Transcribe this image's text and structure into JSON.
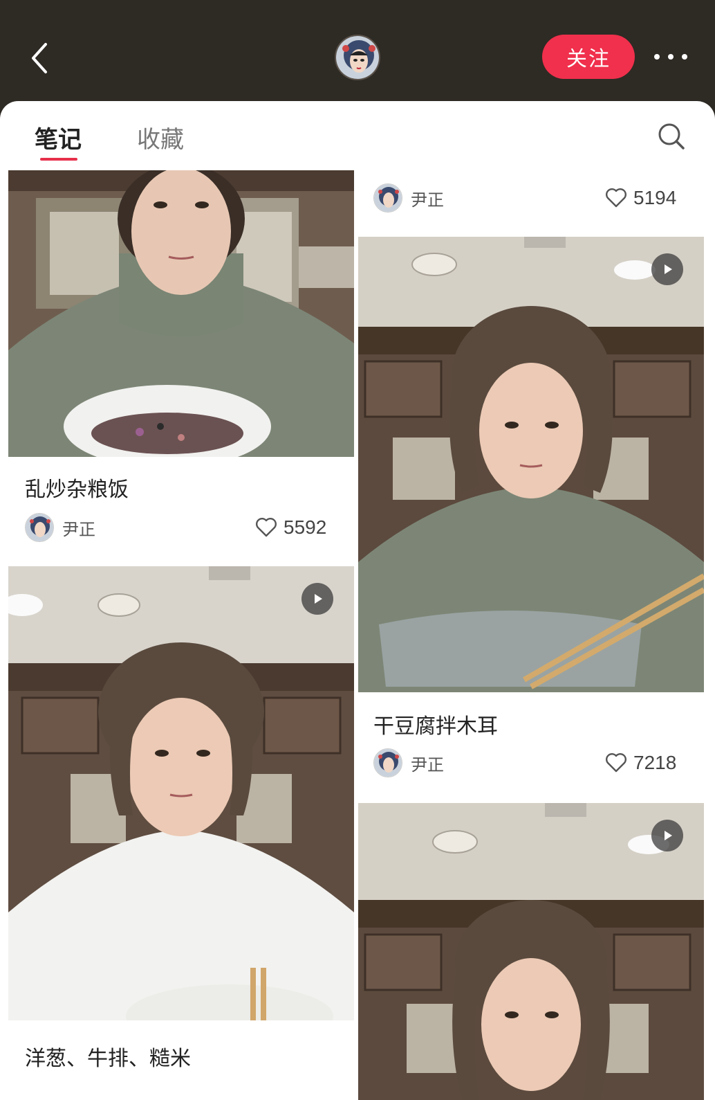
{
  "header": {
    "follow_label": "关注"
  },
  "tabs": [
    {
      "label": "笔记",
      "active": true
    },
    {
      "label": "收藏",
      "active": false
    }
  ],
  "author": "尹正",
  "notes": [
    {
      "title": "乱炒杂粮饭",
      "author": "尹正",
      "likes": "5592",
      "video": false
    },
    {
      "title": "",
      "author": "尹正",
      "likes": "5194",
      "video": false
    },
    {
      "title": "干豆腐拌木耳",
      "author": "尹正",
      "likes": "7218",
      "video": true
    },
    {
      "title": "洋葱、牛排、糙米",
      "author": "",
      "likes": "",
      "video": true
    },
    {
      "title": "",
      "author": "",
      "likes": "",
      "video": true
    }
  ],
  "colors": {
    "accent": "#f0304c",
    "header_bg": "#2e2a24"
  }
}
